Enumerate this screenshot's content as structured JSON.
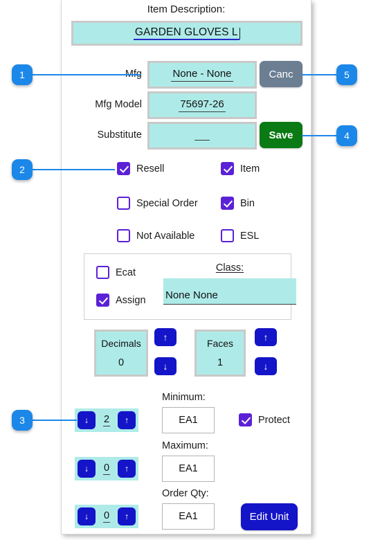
{
  "dialog": {
    "title": "Item Description:",
    "description": {
      "value": "GARDEN GLOVES L",
      "placeholder": "Item description"
    },
    "fields": [
      {
        "label": "Mfg",
        "value": "None - None"
      },
      {
        "label": "Mfg Model",
        "value": "75697-26"
      },
      {
        "label": "Substitute",
        "value": ""
      }
    ],
    "buttons": {
      "cancel": "Canc",
      "save": "Save",
      "edit_unit": "Edit Unit"
    },
    "checkboxes": [
      {
        "label": "Resell",
        "checked": true
      },
      {
        "label": "Item",
        "checked": true
      },
      {
        "label": "Special Order",
        "checked": false
      },
      {
        "label": "Bin",
        "checked": true
      },
      {
        "label": "Not Available",
        "checked": false
      },
      {
        "label": "ESL",
        "checked": false
      }
    ],
    "class_panel": {
      "ecat": {
        "label": "Ecat",
        "checked": false
      },
      "assign": {
        "label": "Assign",
        "checked": true
      },
      "class_label": "Class:",
      "class_value": "None None"
    },
    "counters": [
      {
        "label": "Decimals",
        "value": "0",
        "up": "↑",
        "down": "↓"
      },
      {
        "label": "Faces",
        "value": "1",
        "up": "↑",
        "down": "↓"
      }
    ],
    "quantity_rows": [
      {
        "section": "Minimum:",
        "stepper_value": "2",
        "unit": "EA1",
        "down": "↓",
        "up": "↑"
      },
      {
        "section": "Maximum:",
        "stepper_value": "0",
        "unit": "EA1",
        "down": "↓",
        "up": "↑"
      },
      {
        "section": "Order Qty:",
        "stepper_value": "0",
        "unit": "EA1",
        "down": "↓",
        "up": "↑"
      }
    ],
    "protect": {
      "label": "Protect",
      "checked": true
    }
  },
  "callouts": [
    {
      "number": "1"
    },
    {
      "number": "2"
    },
    {
      "number": "3"
    },
    {
      "number": "4"
    },
    {
      "number": "5"
    }
  ],
  "colors": {
    "accent_blue": "#1414c8",
    "badge_blue": "#1b87e8",
    "checkbox_purple": "#5b21d6",
    "field_cyan": "#aeebe8",
    "save_green": "#0a7a14",
    "cancel_gray": "#6b7e92"
  }
}
